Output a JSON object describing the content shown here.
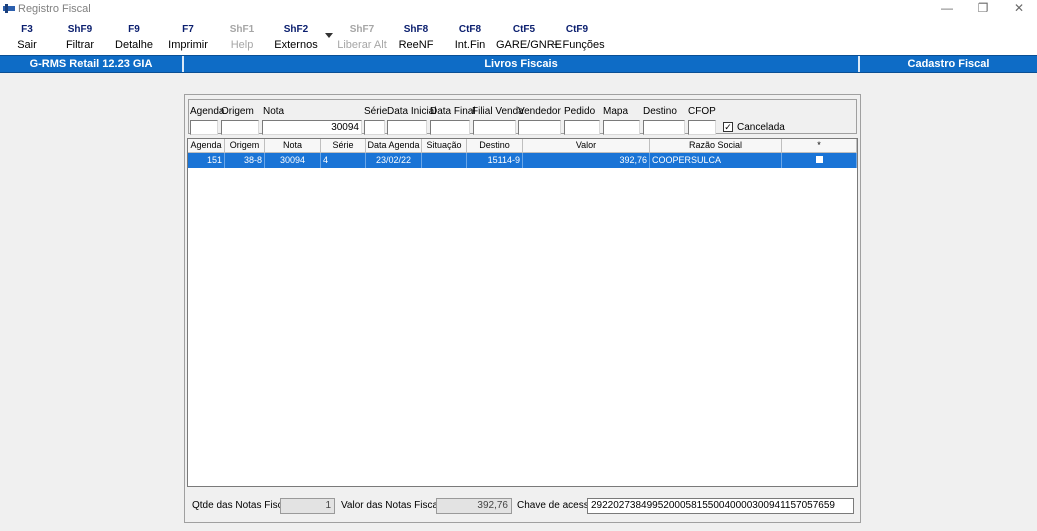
{
  "window": {
    "title": "Registro Fiscal",
    "minimize": "—",
    "restore": "❐",
    "close": "✕"
  },
  "toolbar": [
    {
      "key": "F3",
      "label": "Sair",
      "enabled": true
    },
    {
      "key": "ShF9",
      "label": "Filtrar",
      "enabled": true
    },
    {
      "key": "F9",
      "label": "Detalhe",
      "enabled": true
    },
    {
      "key": "F7",
      "label": "Imprimir",
      "enabled": true
    },
    {
      "key": "ShF1",
      "label": "Help",
      "enabled": false
    },
    {
      "key": "ShF2",
      "label": "Externos",
      "enabled": true
    },
    {
      "key": "ShF7",
      "label": "Liberar Alt",
      "enabled": false
    },
    {
      "key": "ShF8",
      "label": "ReeNF",
      "enabled": true
    },
    {
      "key": "CtF8",
      "label": "Int.Fin",
      "enabled": true
    },
    {
      "key": "CtF5",
      "label": "GARE/GNRE",
      "enabled": true
    },
    {
      "key": "CtF9",
      "label": "+ Funções",
      "enabled": true
    }
  ],
  "band": {
    "left": "G-RMS Retail 12.23 GIA",
    "center": "Livros Fiscais",
    "right": "Cadastro Fiscal"
  },
  "filters": {
    "agenda": {
      "label": "Agenda",
      "value": ""
    },
    "origem": {
      "label": "Origem",
      "value": ""
    },
    "nota": {
      "label": "Nota",
      "value": "30094"
    },
    "serie": {
      "label": "Série",
      "value": ""
    },
    "data_inicial": {
      "label": "Data Inicial",
      "value": ""
    },
    "data_final": {
      "label": "Data Final",
      "value": ""
    },
    "filial_venda": {
      "label": "Filial Venda",
      "value": ""
    },
    "vendedor": {
      "label": "Vendedor",
      "value": ""
    },
    "pedido": {
      "label": "Pedido",
      "value": ""
    },
    "mapa": {
      "label": "Mapa",
      "value": ""
    },
    "destino": {
      "label": "Destino",
      "value": ""
    },
    "cfop": {
      "label": "CFOP",
      "value": ""
    },
    "cancelada": {
      "label": "Cancelada",
      "checked": true,
      "mark": "✓"
    }
  },
  "grid": {
    "columns": [
      "Agenda",
      "Origem",
      "Nota",
      "Série",
      "Data Agenda",
      "Situação",
      "Destino",
      "Valor",
      "Razão Social",
      "*"
    ],
    "rows": [
      {
        "agenda": "151",
        "origem": "38-8",
        "nota": "30094",
        "serie": "4",
        "data_agenda": "23/02/22",
        "situacao": "",
        "destino": "15114-9",
        "valor": "392,76",
        "razao_social": "COOPERSULCA",
        "mark": ""
      }
    ]
  },
  "footer": {
    "qtde_label": "Qtde das Notas Fiscais:",
    "qtde_value": "1",
    "valor_label": "Valor  das Notas Fiscais:",
    "valor_value": "392,76",
    "chave_label": "Chave de acesso:",
    "chave_value": "29220273849952000581550040000300941157057659"
  }
}
